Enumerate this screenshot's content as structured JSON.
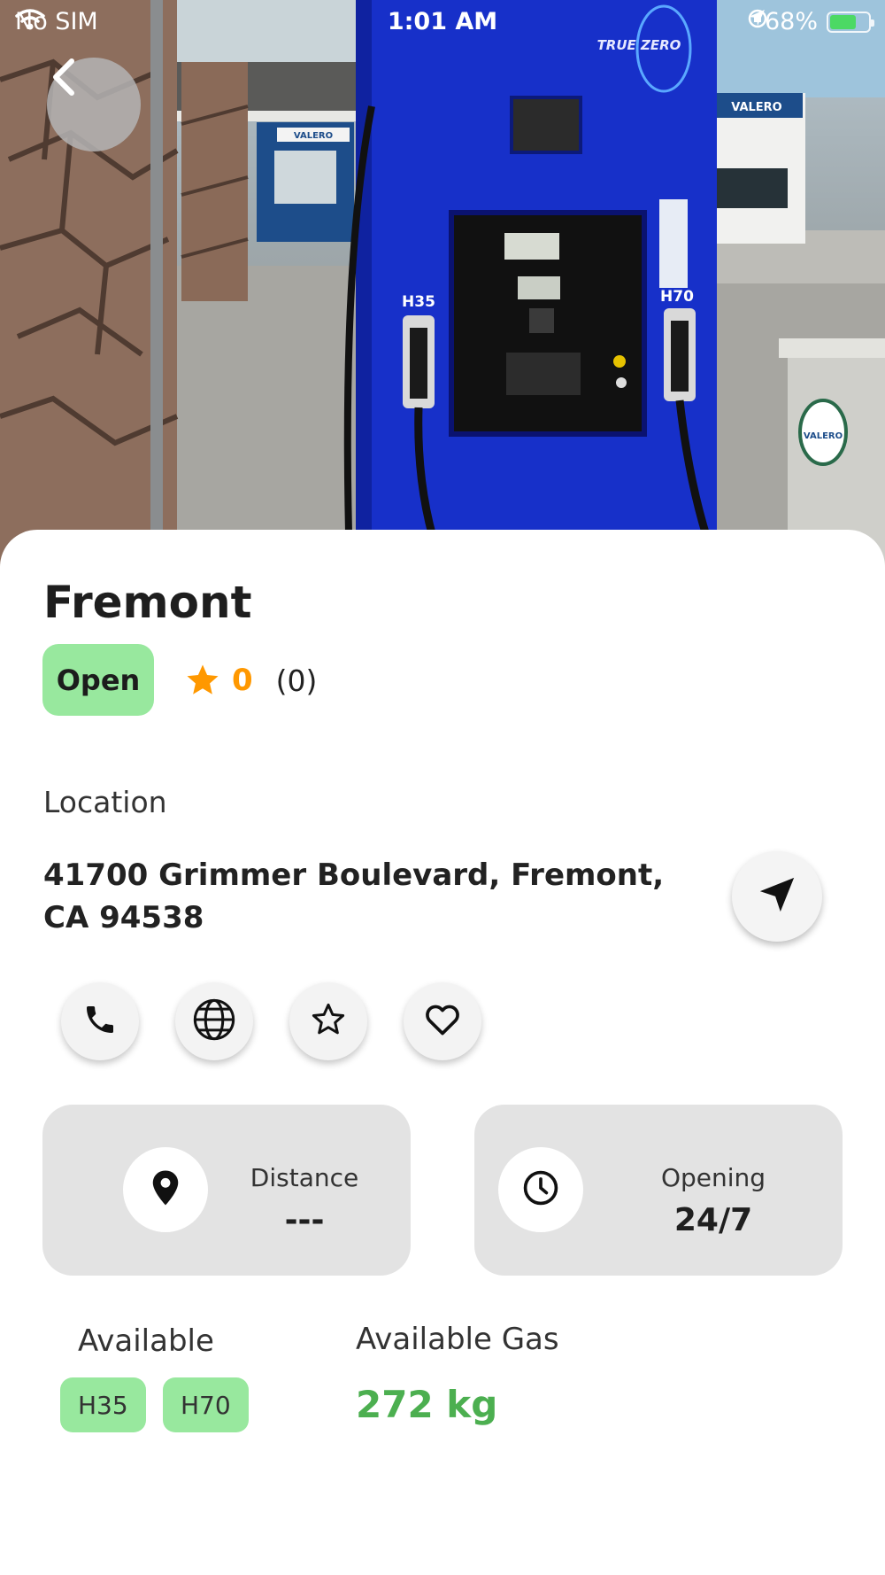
{
  "status_bar": {
    "carrier": "No SIM",
    "time": "1:01 AM",
    "battery": "68%",
    "battery_level": 0.68
  },
  "hero": {
    "photo_text": {
      "brand_left": "VALERO",
      "brand_right": "VALERO",
      "pump_brand": "TRUE ZERO",
      "nozzle_left": "H35",
      "nozzle_right": "H70",
      "sign_logo": "VALERO"
    }
  },
  "station": {
    "name": "Fremont",
    "status": "Open",
    "rating": "0",
    "review_count": "(0)"
  },
  "location": {
    "label": "Location",
    "address": "41700 Grimmer Boulevard, Fremont, CA 94538"
  },
  "actions": [
    {
      "icon": "phone-icon"
    },
    {
      "icon": "globe-icon"
    },
    {
      "icon": "star-outline-icon"
    },
    {
      "icon": "heart-outline-icon"
    }
  ],
  "cards": {
    "distance": {
      "label": "Distance",
      "value": "---"
    },
    "opening": {
      "label": "Opening",
      "value": "24/7"
    }
  },
  "available": {
    "label": "Available",
    "tags": [
      "H35",
      "H70"
    ]
  },
  "gas": {
    "label": "Available Gas",
    "value": "272 kg"
  },
  "colors": {
    "open_badge": "#98e89e",
    "rating_star": "#ff9800",
    "gas_value": "#4caf50",
    "card_bg": "#e3e3e3"
  }
}
